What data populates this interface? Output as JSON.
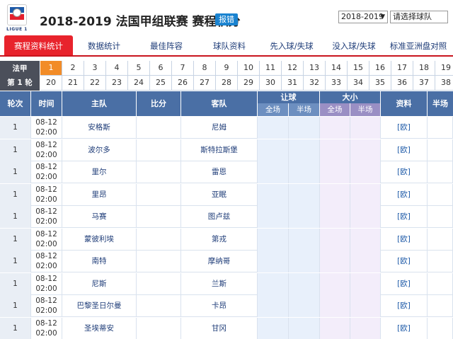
{
  "header": {
    "logo_text": "LIGUE 1",
    "title": "2018-2019 法国甲组联赛 赛程积分",
    "badge": "报错",
    "season_select": "2018-2019",
    "team_select": "请选择球队"
  },
  "nav": [
    "赛程资料统计",
    "数据统计",
    "最佳阵容",
    "球队资料",
    "先入球/失球",
    "没入球/失球",
    "标准亚洲盘对照"
  ],
  "rounds": {
    "league": "法甲",
    "current": "第 1 轮",
    "row1": [
      "1",
      "2",
      "3",
      "4",
      "5",
      "6",
      "7",
      "8",
      "9",
      "10",
      "11",
      "12",
      "13",
      "14",
      "15",
      "16",
      "17",
      "18",
      "19"
    ],
    "row2": [
      "20",
      "21",
      "22",
      "23",
      "24",
      "25",
      "26",
      "27",
      "28",
      "29",
      "30",
      "31",
      "32",
      "33",
      "34",
      "35",
      "36",
      "37",
      "38"
    ]
  },
  "table": {
    "headers": {
      "round": "轮次",
      "time": "时间",
      "home": "主队",
      "score": "比分",
      "away": "客队",
      "handicap": "让球",
      "overunder": "大小",
      "full": "全场",
      "half": "半场",
      "info": "资料",
      "half_score": "半场"
    },
    "rows": [
      {
        "round": "1",
        "date": "08-12",
        "time": "02:00",
        "home": "安格斯",
        "away": "尼姆",
        "info": "[欧]"
      },
      {
        "round": "1",
        "date": "08-12",
        "time": "02:00",
        "home": "波尔多",
        "away": "斯特拉斯堡",
        "info": "[欧]"
      },
      {
        "round": "1",
        "date": "08-12",
        "time": "02:00",
        "home": "里尔",
        "away": "雷恩",
        "info": "[欧]"
      },
      {
        "round": "1",
        "date": "08-12",
        "time": "02:00",
        "home": "里昂",
        "away": "亚眠",
        "info": "[欧]"
      },
      {
        "round": "1",
        "date": "08-12",
        "time": "02:00",
        "home": "马赛",
        "away": "图卢兹",
        "info": "[欧]"
      },
      {
        "round": "1",
        "date": "08-12",
        "time": "02:00",
        "home": "蒙彼利埃",
        "away": "第戎",
        "info": "[欧]"
      },
      {
        "round": "1",
        "date": "08-12",
        "time": "02:00",
        "home": "南特",
        "away": "摩纳哥",
        "info": "[欧]"
      },
      {
        "round": "1",
        "date": "08-12",
        "time": "02:00",
        "home": "尼斯",
        "away": "兰斯",
        "info": "[欧]"
      },
      {
        "round": "1",
        "date": "08-12",
        "time": "02:00",
        "home": "巴黎圣日尔曼",
        "away": "卡昂",
        "info": "[欧]"
      },
      {
        "round": "1",
        "date": "08-12",
        "time": "02:00",
        "home": "圣埃蒂安",
        "away": "甘冈",
        "info": "[欧]"
      }
    ]
  }
}
